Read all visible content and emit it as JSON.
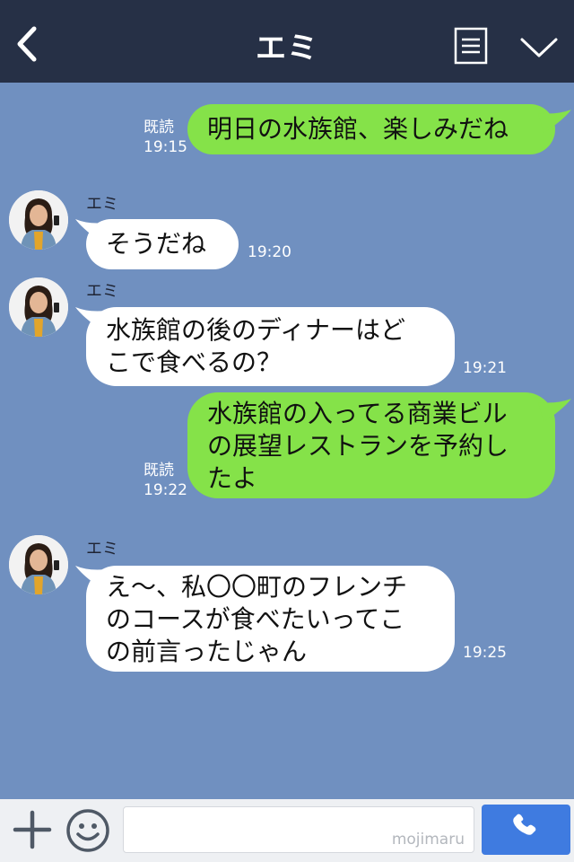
{
  "header": {
    "title": "エミ"
  },
  "messages": [
    {
      "side": "right",
      "text_lines": [
        "明日の水族館、楽しみだね"
      ],
      "read_label": "既読",
      "time": "19:15"
    },
    {
      "side": "left",
      "sender": "エミ",
      "text_lines": [
        "そうだね"
      ],
      "time": "19:20"
    },
    {
      "side": "left",
      "sender": "エミ",
      "text_lines": [
        "水族館の後のディナーはど",
        "こで食べるの？"
      ],
      "time": "19:21"
    },
    {
      "side": "right",
      "text_lines": [
        "水族館の入ってる商業ビル",
        "の展望レストランを予約し",
        "たよ"
      ],
      "read_label": "既読",
      "time": "19:22"
    },
    {
      "side": "left",
      "sender": "エミ",
      "text_lines": [
        "え〜、私〇〇町のフレンチ",
        "のコースが食べたいってこ",
        "の前言ったじゃん"
      ],
      "time": "19:25"
    }
  ],
  "footer": {
    "watermark": "mojimaru"
  },
  "colors": {
    "header_bg": "#263046",
    "chat_bg": "#7090c0",
    "bubble_right": "#85e249",
    "bubble_left": "#ffffff",
    "call_button": "#3f7be0"
  },
  "icons": [
    "back-icon",
    "menu-icon",
    "chevron-down-icon",
    "plus-icon",
    "smile-icon",
    "phone-icon"
  ]
}
